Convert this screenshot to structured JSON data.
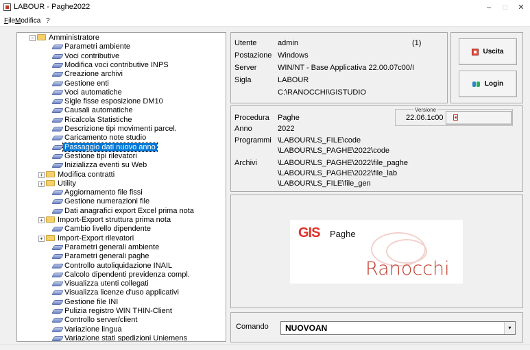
{
  "window": {
    "title": "LABOUR - Paghe2022",
    "min": "–",
    "max": "□",
    "close": "✕"
  },
  "menu": [
    {
      "accel": "F",
      "rest": "ile"
    },
    {
      "accel": "M",
      "rest": "odifica"
    },
    {
      "accel": "",
      "rest": "?"
    }
  ],
  "tree": {
    "root": "Amministratore",
    "items": [
      {
        "label": "Parametri ambiente",
        "type": "leaf"
      },
      {
        "label": "Voci contributive",
        "type": "leaf"
      },
      {
        "label": "Modifica voci contributive INPS",
        "type": "leaf"
      },
      {
        "label": "Creazione archivi",
        "type": "leaf"
      },
      {
        "label": "Gestione enti",
        "type": "leaf"
      },
      {
        "label": "Voci automatiche",
        "type": "leaf"
      },
      {
        "label": "Sigle fisse esposizione DM10",
        "type": "leaf"
      },
      {
        "label": "Causali automatiche",
        "type": "leaf"
      },
      {
        "label": "Ricalcola Statistiche",
        "type": "leaf"
      },
      {
        "label": "Descrizione tipi movimenti parcel.",
        "type": "leaf"
      },
      {
        "label": "Caricamento note studio",
        "type": "leaf"
      },
      {
        "label": "Passaggio dati nuovo anno",
        "type": "leaf",
        "selected": true
      },
      {
        "label": "Gestione tipi rilevatori",
        "type": "leaf"
      },
      {
        "label": "Inizializza eventi su Web",
        "type": "leaf"
      },
      {
        "label": "Modifica contratti",
        "type": "folder"
      },
      {
        "label": "Utility",
        "type": "folder"
      },
      {
        "label": "Aggiornamento file fissi",
        "type": "leaf"
      },
      {
        "label": "Gestione numerazioni file",
        "type": "leaf"
      },
      {
        "label": "Dati anagrafici export Excel prima nota",
        "type": "leaf"
      },
      {
        "label": "Import-Export struttura prima nota",
        "type": "folder"
      },
      {
        "label": "Cambio livello dipendente",
        "type": "leaf"
      },
      {
        "label": "Import-Export rilevatori",
        "type": "folder"
      },
      {
        "label": "Parametri generali ambiente",
        "type": "leaf"
      },
      {
        "label": "Parametri generali paghe",
        "type": "leaf"
      },
      {
        "label": "Controllo autoliquidazione INAIL",
        "type": "leaf"
      },
      {
        "label": "Calcolo dipendenti previdenza compl.",
        "type": "leaf"
      },
      {
        "label": "Visualizza utenti collegati",
        "type": "leaf"
      },
      {
        "label": "Visualizza licenze d'uso applicativi",
        "type": "leaf"
      },
      {
        "label": "Gestione file INI",
        "type": "leaf"
      },
      {
        "label": "Pulizia registro WIN THIN-Client",
        "type": "leaf"
      },
      {
        "label": "Controllo server/client",
        "type": "leaf"
      },
      {
        "label": "Variazione lingua",
        "type": "leaf"
      },
      {
        "label": "Variazione stati spedizioni Uniemens",
        "type": "leaf"
      }
    ],
    "scroll_position": 0.44
  },
  "session": {
    "utente_label": "Utente",
    "utente": "admin",
    "count": "(1)",
    "postazione_label": "Postazione",
    "postazione": "Windows",
    "server_label": "Server",
    "server": "WIN/NT - Base Applicativa 22.00.07c00/I",
    "sigla_label": "Sigla",
    "sigla": "LABOUR",
    "path": "C:\\RANOCCHI\\GISTUDIO"
  },
  "actions": {
    "exit": "Uscita",
    "login": "Login"
  },
  "procedure": {
    "procedura_label": "Procedura",
    "procedura": "Paghe",
    "anno_label": "Anno",
    "anno": "2022",
    "programmi_label": "Programmi",
    "programmi": [
      "\\LABOUR\\LS_FILE\\code",
      "\\LABOUR\\LS_PAGHE\\2022\\code"
    ],
    "archivi_label": "Archivi",
    "archivi": [
      "\\LABOUR\\LS_PAGHE\\2022\\file_paghe",
      "\\LABOUR\\LS_PAGHE\\2022\\file_lab",
      "\\LABOUR\\LS_FILE\\file_gen"
    ],
    "versione_label": "Versione",
    "versione": "22.06.1c00"
  },
  "logo": {
    "brand": "GIS",
    "product": "Paghe",
    "company": "Ranocchi"
  },
  "command": {
    "label": "Comando",
    "value": "NUOVOAN",
    "arrow": "▾"
  },
  "colors": {
    "selection": "#0078d7",
    "brand_red": "#e0332b"
  }
}
